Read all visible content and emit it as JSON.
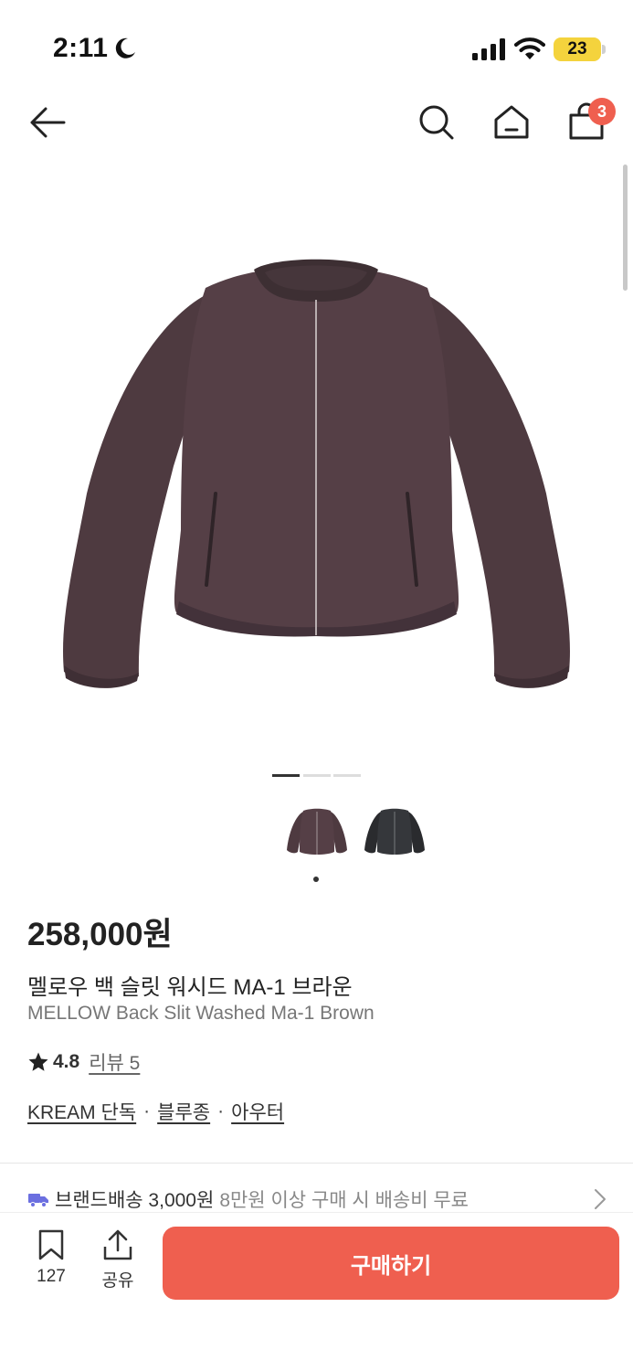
{
  "status_bar": {
    "time": "2:11",
    "battery": "23"
  },
  "nav": {
    "cart_count": "3"
  },
  "product": {
    "price": "258,000원",
    "name_ko": "멜로우 백 슬릿 워시드 MA-1 브라운",
    "name_en": "MELLOW Back Slit Washed Ma-1 Brown",
    "rating": "4.8",
    "review": "리뷰 5",
    "tags": [
      "KREAM 단독",
      "블루종",
      "아우터"
    ],
    "image_count": 3,
    "image_index": 1
  },
  "shipping": {
    "label": "브랜드배송 3,000원",
    "desc": "8만원 이상 구매 시 배송비 무료"
  },
  "bottom": {
    "bookmark_count": "127",
    "share_label": "공유",
    "buy_label": "구매하기"
  },
  "colors": {
    "accent": "#ef5f4f",
    "battery": "#f4d33d",
    "jacket": "#4e3a40",
    "jacket_alt": "#2a2b2e"
  },
  "icons": [
    "moon-icon",
    "signal-icon",
    "wifi-icon",
    "back-arrow-icon",
    "search-icon",
    "home-icon",
    "shopping-bag-icon",
    "star-icon",
    "truck-icon",
    "chevron-right-icon",
    "bookmark-icon",
    "share-icon"
  ]
}
